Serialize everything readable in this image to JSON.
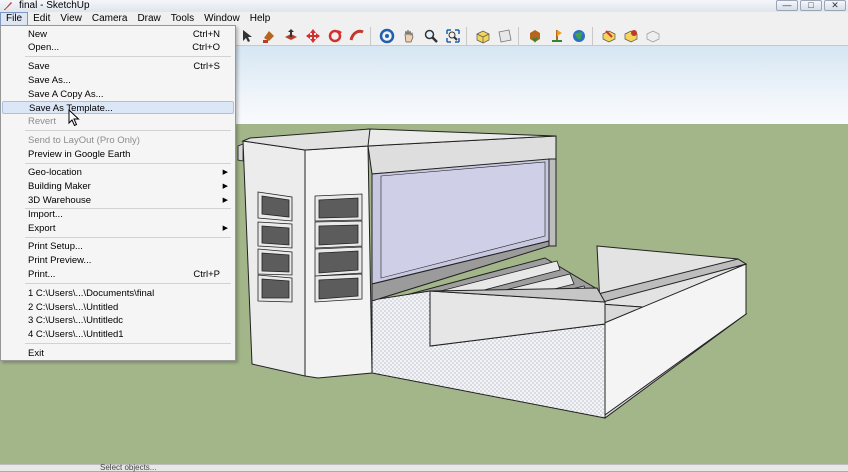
{
  "window": {
    "title": "final - SketchUp",
    "buttons": [
      "—",
      "□",
      "✕"
    ]
  },
  "menubar": [
    "File",
    "Edit",
    "View",
    "Camera",
    "Draw",
    "Tools",
    "Window",
    "Help"
  ],
  "toolbar": {
    "icons": [
      "select-icon",
      "paint-icon",
      "push-pull-icon",
      "move-icon",
      "rotate-icon",
      "follow-me-icon",
      "orbit-icon",
      "pan-icon",
      "zoom-icon",
      "zoom-extents-icon",
      "iso-view-icon",
      "top-view-icon",
      "get-models-icon",
      "add-location-icon",
      "google-earth-icon",
      "share-model-icon",
      "components-icon",
      "extension-icon"
    ]
  },
  "file_menu": {
    "items": [
      {
        "label": "New",
        "shortcut": "Ctrl+N"
      },
      {
        "label": "Open...",
        "shortcut": "Ctrl+O"
      },
      {
        "label": "Save",
        "shortcut": "Ctrl+S"
      },
      {
        "label": "Save As..."
      },
      {
        "label": "Save A Copy As..."
      },
      {
        "label": "Save As Template..."
      },
      {
        "label": "Revert"
      },
      {
        "label": "Send to LayOut (Pro Only)"
      },
      {
        "label": "Preview in Google Earth"
      },
      {
        "label": "Geo-location"
      },
      {
        "label": "Building Maker"
      },
      {
        "label": "3D Warehouse"
      },
      {
        "label": "Import..."
      },
      {
        "label": "Export"
      },
      {
        "label": "Print Setup..."
      },
      {
        "label": "Print Preview..."
      },
      {
        "label": "Print...",
        "shortcut": "Ctrl+P"
      },
      {
        "label": "1 C:\\Users\\...\\Documents\\final"
      },
      {
        "label": "2 C:\\Users\\...\\Untitled"
      },
      {
        "label": "3 C:\\Users\\...\\Untitledc"
      },
      {
        "label": "4 C:\\Users\\...\\Untitled1"
      },
      {
        "label": "Exit"
      }
    ],
    "hovered": "Save As Template...",
    "disabled": [
      "Revert",
      "Send to LayOut (Pro Only)"
    ]
  },
  "statusbar": {
    "text": "Select objects..."
  },
  "colors": {
    "sky": "#f7fafd",
    "ground": "#a3b68a",
    "menu_highlight": "#dbe6f6"
  }
}
